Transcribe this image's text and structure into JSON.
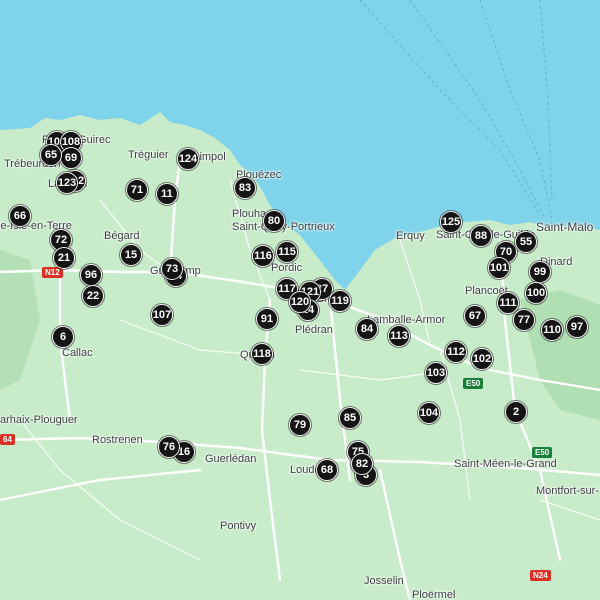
{
  "places": [
    {
      "id": "perros-guirec",
      "label": "Perros-Guirec"
    },
    {
      "id": "trebeurden",
      "label": "Trébeurden"
    },
    {
      "id": "treguier",
      "label": "Tréguier"
    },
    {
      "id": "paimpol",
      "label": "Paimpol"
    },
    {
      "id": "plouezec",
      "label": "Plouézec"
    },
    {
      "id": "plouha",
      "label": "Plouha"
    },
    {
      "id": "saint-quay",
      "label": "Saint-Quay-Portrieux"
    },
    {
      "id": "lannion",
      "label": "Lannion"
    },
    {
      "id": "belle-isle",
      "label": "Belle-Isle-en-Terre"
    },
    {
      "id": "begard",
      "label": "Bégard"
    },
    {
      "id": "guingamp",
      "label": "Guingamp"
    },
    {
      "id": "pordic",
      "label": "Pordic"
    },
    {
      "id": "saint-brieuc",
      "label": "Saint-Brieuc"
    },
    {
      "id": "erquy",
      "label": "Erquy"
    },
    {
      "id": "saint-cast",
      "label": "Saint-Cast-le-Guildo"
    },
    {
      "id": "saint-malo",
      "label": "Saint-Malo"
    },
    {
      "id": "dinard",
      "label": "Dinard"
    },
    {
      "id": "plancoet",
      "label": "Plancoët"
    },
    {
      "id": "lamballe",
      "label": "Lamballe-Armor"
    },
    {
      "id": "pledran",
      "label": "Plédran"
    },
    {
      "id": "callac",
      "label": "Callac"
    },
    {
      "id": "quintin",
      "label": "Quintin"
    },
    {
      "id": "carhaix",
      "label": "Carhaix-Plouguer"
    },
    {
      "id": "rostrenen",
      "label": "Rostrenen"
    },
    {
      "id": "guerledan",
      "label": "Guerlédan"
    },
    {
      "id": "loudeac",
      "label": "Loudéac"
    },
    {
      "id": "saint-meen",
      "label": "Saint-Méen-le-Grand"
    },
    {
      "id": "montfort",
      "label": "Montfort-sur-Meu"
    },
    {
      "id": "pontivy",
      "label": "Pontivy"
    },
    {
      "id": "josselin",
      "label": "Josselin"
    },
    {
      "id": "ploermel",
      "label": "Ploërmel"
    }
  ],
  "roads": [
    {
      "id": "n12",
      "label": "N12",
      "color": "#d93025"
    },
    {
      "id": "e50a",
      "label": "E50",
      "color": "#188038"
    },
    {
      "id": "e50b",
      "label": "E50",
      "color": "#188038"
    },
    {
      "id": "n24",
      "label": "N24",
      "color": "#d93025"
    },
    {
      "id": "r164",
      "label": "64",
      "color": "#d93025"
    }
  ],
  "markers": [
    {
      "id": "109",
      "label": "109"
    },
    {
      "id": "108",
      "label": "108"
    },
    {
      "id": "69",
      "label": "69"
    },
    {
      "id": "65",
      "label": "65"
    },
    {
      "id": "123",
      "label": "123"
    },
    {
      "id": "122",
      "label": "122"
    },
    {
      "id": "124",
      "label": "124"
    },
    {
      "id": "71",
      "label": "71"
    },
    {
      "id": "11",
      "label": "11"
    },
    {
      "id": "83",
      "label": "83"
    },
    {
      "id": "66",
      "label": "66"
    },
    {
      "id": "72",
      "label": "72"
    },
    {
      "id": "21",
      "label": "21"
    },
    {
      "id": "15",
      "label": "15"
    },
    {
      "id": "96",
      "label": "96"
    },
    {
      "id": "22",
      "label": "22"
    },
    {
      "id": "73",
      "label": "73"
    },
    {
      "id": "74",
      "label": "74"
    },
    {
      "id": "80",
      "label": "80"
    },
    {
      "id": "116",
      "label": "116"
    },
    {
      "id": "115",
      "label": "115"
    },
    {
      "id": "117",
      "label": "117"
    },
    {
      "id": "121",
      "label": "121"
    },
    {
      "id": "27",
      "label": "27"
    },
    {
      "id": "119",
      "label": "119"
    },
    {
      "id": "120",
      "label": "120"
    },
    {
      "id": "14",
      "label": "14"
    },
    {
      "id": "107",
      "label": "107"
    },
    {
      "id": "6",
      "label": "6"
    },
    {
      "id": "91",
      "label": "91"
    },
    {
      "id": "118",
      "label": "118"
    },
    {
      "id": "84",
      "label": "84"
    },
    {
      "id": "113",
      "label": "113"
    },
    {
      "id": "125",
      "label": "125"
    },
    {
      "id": "88",
      "label": "88"
    },
    {
      "id": "70",
      "label": "70"
    },
    {
      "id": "55",
      "label": "55"
    },
    {
      "id": "101",
      "label": "101"
    },
    {
      "id": "99",
      "label": "99"
    },
    {
      "id": "100",
      "label": "100"
    },
    {
      "id": "111",
      "label": "111"
    },
    {
      "id": "67",
      "label": "67"
    },
    {
      "id": "77",
      "label": "77"
    },
    {
      "id": "110",
      "label": "110"
    },
    {
      "id": "97",
      "label": "97"
    },
    {
      "id": "112",
      "label": "112"
    },
    {
      "id": "102",
      "label": "102"
    },
    {
      "id": "103",
      "label": "103"
    },
    {
      "id": "104",
      "label": "104"
    },
    {
      "id": "2",
      "label": "2"
    },
    {
      "id": "85",
      "label": "85"
    },
    {
      "id": "79",
      "label": "79"
    },
    {
      "id": "75",
      "label": "75"
    },
    {
      "id": "82",
      "label": "82"
    },
    {
      "id": "3",
      "label": "3"
    },
    {
      "id": "68",
      "label": "68"
    },
    {
      "id": "76",
      "label": "76"
    },
    {
      "id": "16",
      "label": "16"
    }
  ],
  "colors": {
    "sea": "#7fd3ea",
    "land": "#c8ecc9",
    "forest": "#a9dcae",
    "road": "#ffffff",
    "marker": "#141414"
  }
}
